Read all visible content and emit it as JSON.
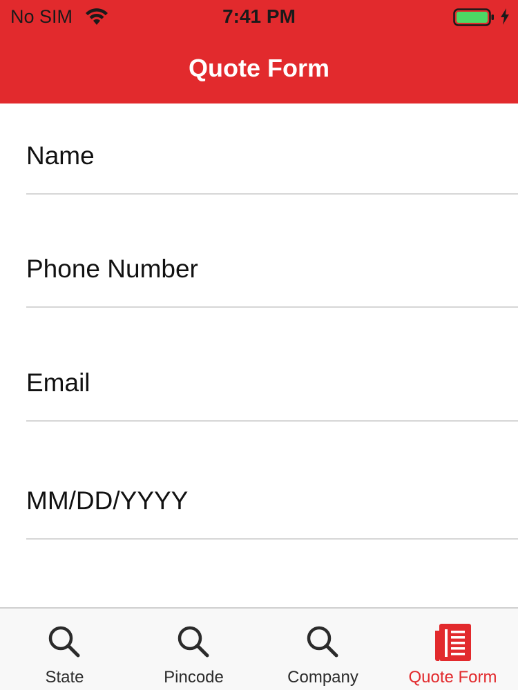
{
  "status_bar": {
    "carrier": "No SIM",
    "time": "7:41 PM",
    "wifi_icon": "wifi-icon",
    "battery_icon": "battery-icon",
    "charging_icon": "charging-bolt-icon",
    "battery_color": "#4cd964"
  },
  "nav": {
    "title": "Quote Form",
    "background_color": "#e22a2d"
  },
  "form": {
    "fields": [
      {
        "placeholder": "Name",
        "value": ""
      },
      {
        "placeholder": "Phone Number",
        "value": ""
      },
      {
        "placeholder": "Email",
        "value": ""
      },
      {
        "placeholder": "MM/DD/YYYY",
        "value": ""
      },
      {
        "placeholder": "",
        "value": ""
      }
    ]
  },
  "tab_bar": {
    "tabs": [
      {
        "label": "State",
        "icon": "search-icon",
        "active": false
      },
      {
        "label": "Pincode",
        "icon": "search-icon",
        "active": false
      },
      {
        "label": "Company",
        "icon": "search-icon",
        "active": false
      },
      {
        "label": "Quote Form",
        "icon": "form-document-icon",
        "active": true
      }
    ],
    "active_color": "#e22a2d",
    "inactive_color": "#2b2b2b"
  }
}
